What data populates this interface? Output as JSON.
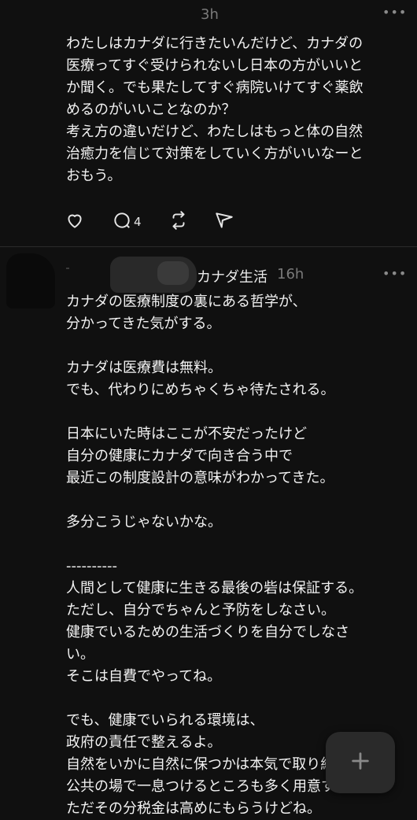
{
  "post1": {
    "time": "3h",
    "more": "•••",
    "text": "わたしはカナダに行きたいんだけど、カナダの\n医療ってすぐ受けられないし日本の方がいいと\nか聞く。でも果たしてすぐ病院いけてすぐ薬飲\nめるのがいいことなのか？\n考え方の違いだけど、わたしはもっと体の自然\n治癒力を信じて対策をしていく方がいいなーと\nおもう。",
    "reply_count": "4"
  },
  "post2": {
    "handle": "カナダ生活",
    "time": "16h",
    "more": "•••",
    "text": "カナダの医療制度の裏にある哲学が、\n分かってきた気がする。\n\nカナダは医療費は無料。\nでも、代わりにめちゃくちゃ待たされる。\n\n日本にいた時はここが不安だったけど\n自分の健康にカナダで向き合う中で\n最近この制度設計の意味がわかってきた。\n\n多分こうじゃないかな。\n\n----------\n人間として健康に生きる最後の砦は保証する。\nただし、自分でちゃんと予防をしなさい。\n健康でいるための生活づくりを自分でしなさ\nい。\nそこは自費でやってね。\n\nでも、健康でいられる環境は、\n政府の責任で整えるよ。\n自然をいかに自然に保つかは本気で取り組むし\n公共の場で一息つけるところも多く用意する。\nただその分税金は高めにもらうけどね。"
  },
  "icons": {
    "like": "heart-icon",
    "reply": "comment-icon",
    "repost": "repost-icon",
    "share": "send-icon",
    "compose": "plus-icon"
  }
}
